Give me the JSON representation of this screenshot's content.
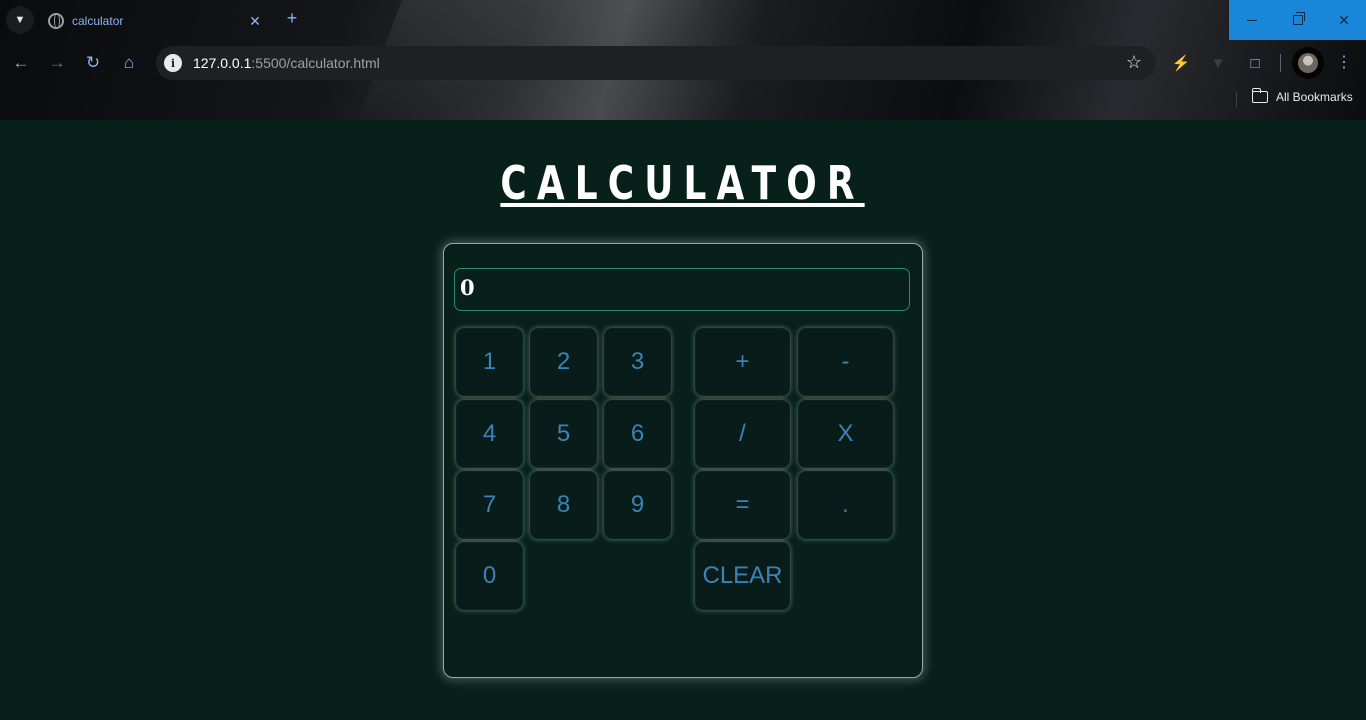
{
  "browser": {
    "tab_title": "calculator",
    "url_host": "127.0.0.1",
    "url_path": ":5500/calculator.html",
    "bookmarks_label": "All Bookmarks",
    "accent": "#8ab4f8",
    "window_controls_color": "#1a86d9"
  },
  "page": {
    "heading": "CALCULATOR",
    "display_value": "0",
    "background": "#07201a",
    "key_text_color": "#3b82b7"
  },
  "keys": {
    "k1": "1",
    "k2": "2",
    "k3": "3",
    "k4": "4",
    "k5": "5",
    "k6": "6",
    "k7": "7",
    "k8": "8",
    "k9": "9",
    "k0": "0",
    "plus": "+",
    "minus": "-",
    "divide": "/",
    "multiply": "X",
    "equals": "=",
    "decimal": ".",
    "clear": "CLEAR"
  }
}
